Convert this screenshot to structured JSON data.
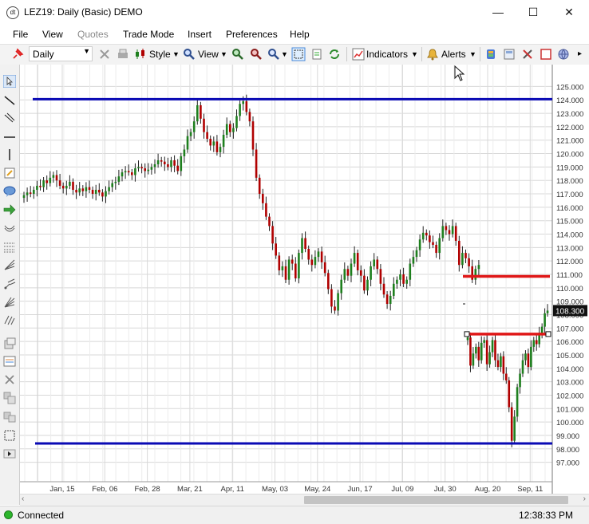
{
  "window": {
    "app_icon_text": "dt",
    "title": "LEZ19: Daily (Basic) DEMO",
    "minimize": "—",
    "maximize": "☐",
    "close": "✕"
  },
  "menu": {
    "file": "File",
    "view": "View",
    "quotes": "Quotes",
    "trade_mode": "Trade Mode",
    "insert": "Insert",
    "preferences": "Preferences",
    "help": "Help"
  },
  "toolbar": {
    "period": "Daily",
    "style_label": "Style",
    "view_label": "View",
    "indicators_label": "Indicators",
    "alerts_label": "Alerts"
  },
  "status": {
    "connection": "Connected",
    "time": "12:38:33 PM"
  },
  "colors": {
    "up_candle": "#1e7f1e",
    "down_candle": "#b00000",
    "blue_line": "#0a0ab4",
    "red_line": "#e01818",
    "price_tag_bg": "#111111",
    "grid": "#d8d8d8"
  },
  "chart_data": {
    "type": "candlestick",
    "symbol": "LEZ19",
    "interval": "Daily",
    "ylim": [
      96.5,
      125.5
    ],
    "y_ticks": [
      "97.000",
      "98.000",
      "99.000",
      "100.000",
      "101.000",
      "102.000",
      "103.000",
      "104.000",
      "105.000",
      "106.000",
      "107.000",
      "108.000",
      "109.000",
      "110.000",
      "111.000",
      "112.000",
      "113.000",
      "114.000",
      "115.000",
      "116.000",
      "117.000",
      "118.000",
      "119.000",
      "120.000",
      "121.000",
      "122.000",
      "123.000",
      "124.000",
      "125.000"
    ],
    "x_ticks": [
      "Jan, 15",
      "Feb, 06",
      "Feb, 28",
      "Mar, 21",
      "Apr, 11",
      "May, 03",
      "May, 24",
      "Jun, 17",
      "Jul, 09",
      "Jul, 30",
      "Aug, 20",
      "Sep, 11"
    ],
    "last_price_label": "108.300",
    "last_price": 108.3,
    "series_a_close": [
      116.9,
      117.1,
      117.0,
      117.3,
      117.6,
      117.5,
      118.0,
      117.8,
      118.2,
      118.4,
      118.0,
      117.6,
      117.4,
      117.6,
      117.9,
      117.3,
      117.1,
      117.4,
      117.2,
      117.5,
      117.3,
      117.0,
      117.3,
      117.1,
      116.8,
      117.2,
      117.5,
      117.8,
      117.9,
      118.3,
      118.6,
      118.7,
      118.6,
      118.4,
      118.9,
      119.0,
      118.9,
      118.7,
      118.8,
      119.0,
      119.2,
      119.5,
      119.4,
      119.2,
      119.0,
      119.5,
      119.1,
      118.7,
      119.8,
      120.3,
      121.3,
      121.6,
      122.4,
      123.6,
      122.6,
      121.6,
      121.1,
      120.6,
      120.9,
      120.1,
      120.5,
      121.4,
      122.2,
      121.6,
      121.9,
      122.8,
      123.7,
      123.9,
      123.1,
      122.4,
      120.3,
      118.2,
      117.0,
      116.3,
      115.3,
      114.6,
      113.3,
      112.4,
      111.3,
      111.6,
      110.6,
      112.1,
      111.8,
      110.7,
      112.6,
      113.7,
      112.9,
      112.1,
      111.7,
      112.3,
      112.7,
      111.9,
      111.1,
      109.9,
      108.6,
      108.3,
      109.6,
      110.6,
      111.4,
      110.9,
      111.8,
      112.6,
      111.3,
      110.9,
      109.8,
      110.6,
      111.6,
      112.1,
      111.4,
      110.3,
      109.5,
      108.8,
      109.4,
      110.3,
      110.6,
      111.0,
      110.3,
      110.6,
      111.8,
      112.3,
      112.8,
      113.6,
      114.1,
      113.9,
      113.4,
      113.2,
      112.6,
      113.7,
      114.6,
      114.3,
      114.0,
      114.6,
      113.5,
      111.7,
      112.6,
      112.2,
      111.6,
      110.6,
      111.4,
      111.7
    ],
    "series_b_close": [
      106.3,
      104.2,
      105.1,
      105.6,
      104.6,
      105.9,
      106.1,
      104.3,
      105.2,
      106.1,
      104.6,
      104.1,
      104.9,
      103.6,
      103.1,
      101.1,
      98.6,
      100.4,
      102.6,
      103.6,
      104.6,
      105.1,
      104.1,
      105.6,
      106.1,
      105.8,
      106.6,
      107.1,
      108.1,
      108.3
    ],
    "horizontal_lines": [
      {
        "color": "blue",
        "value": 124.05
      },
      {
        "color": "blue",
        "value": 98.4
      },
      {
        "color": "red",
        "value": 110.85
      },
      {
        "color": "red",
        "value": 106.55
      }
    ]
  }
}
